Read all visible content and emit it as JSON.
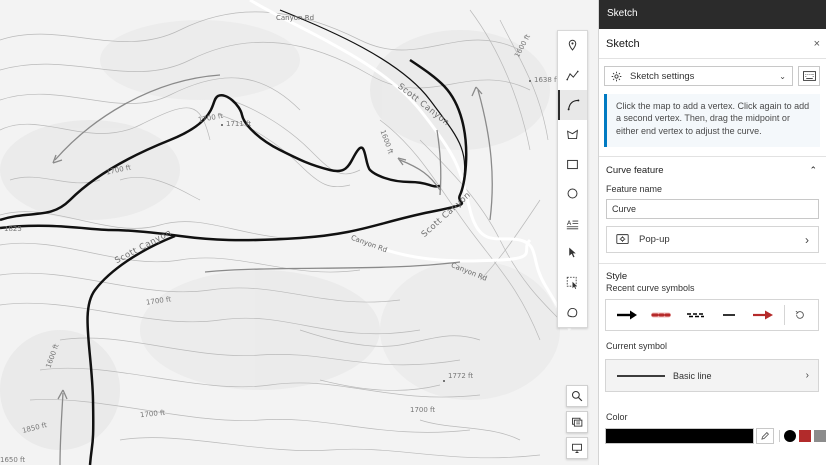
{
  "panel": {
    "top_title": "Sketch",
    "header_title": "Sketch",
    "close_label": "×",
    "settings_label": "Sketch settings",
    "notice": "Click the map to add a vertex. Click again to add a second vertex. Then, drag the midpoint or either end vertex to adjust the curve.",
    "curve_feature": {
      "title": "Curve feature",
      "feature_name_label": "Feature name",
      "feature_name_value": "Curve",
      "popup_label": "Pop-up"
    },
    "style": {
      "title": "Style",
      "recent_label": "Recent curve symbols",
      "recent_symbols": [
        "arrow-black",
        "red-dashed-rounded",
        "checker-dashed",
        "solid-short",
        "arrow-red"
      ],
      "current_label": "Current symbol",
      "current_value": "Basic line",
      "color_label": "Color",
      "current_color": "#000000",
      "preset_colors": [
        "#000000",
        "#b22b2b",
        "#8c8c8c"
      ]
    }
  },
  "tools": [
    "point-icon",
    "polyline-icon",
    "curve-icon",
    "polygon-icon",
    "rectangle-icon",
    "circle-icon",
    "text-icon",
    "select-icon",
    "lasso-select-icon",
    "freehand-icon"
  ],
  "active_tool": "curve-icon",
  "map": {
    "road_labels": [
      "Canyon Rd",
      "Canyon Rd",
      "Canyon Rd"
    ],
    "canyon_labels": [
      "Scott Canyon",
      "Scott Canyon",
      "Scott Canyon"
    ],
    "elevation_labels": [
      "1700 ft",
      "1711 ft",
      "1700 ft",
      "1638 ft",
      "1600 ft",
      "1600 ft",
      "1825",
      "1700 ft",
      "1600 ft",
      "1850 ft",
      "1700 ft",
      "1772 ft",
      "1700 ft",
      "1650 ft"
    ]
  }
}
